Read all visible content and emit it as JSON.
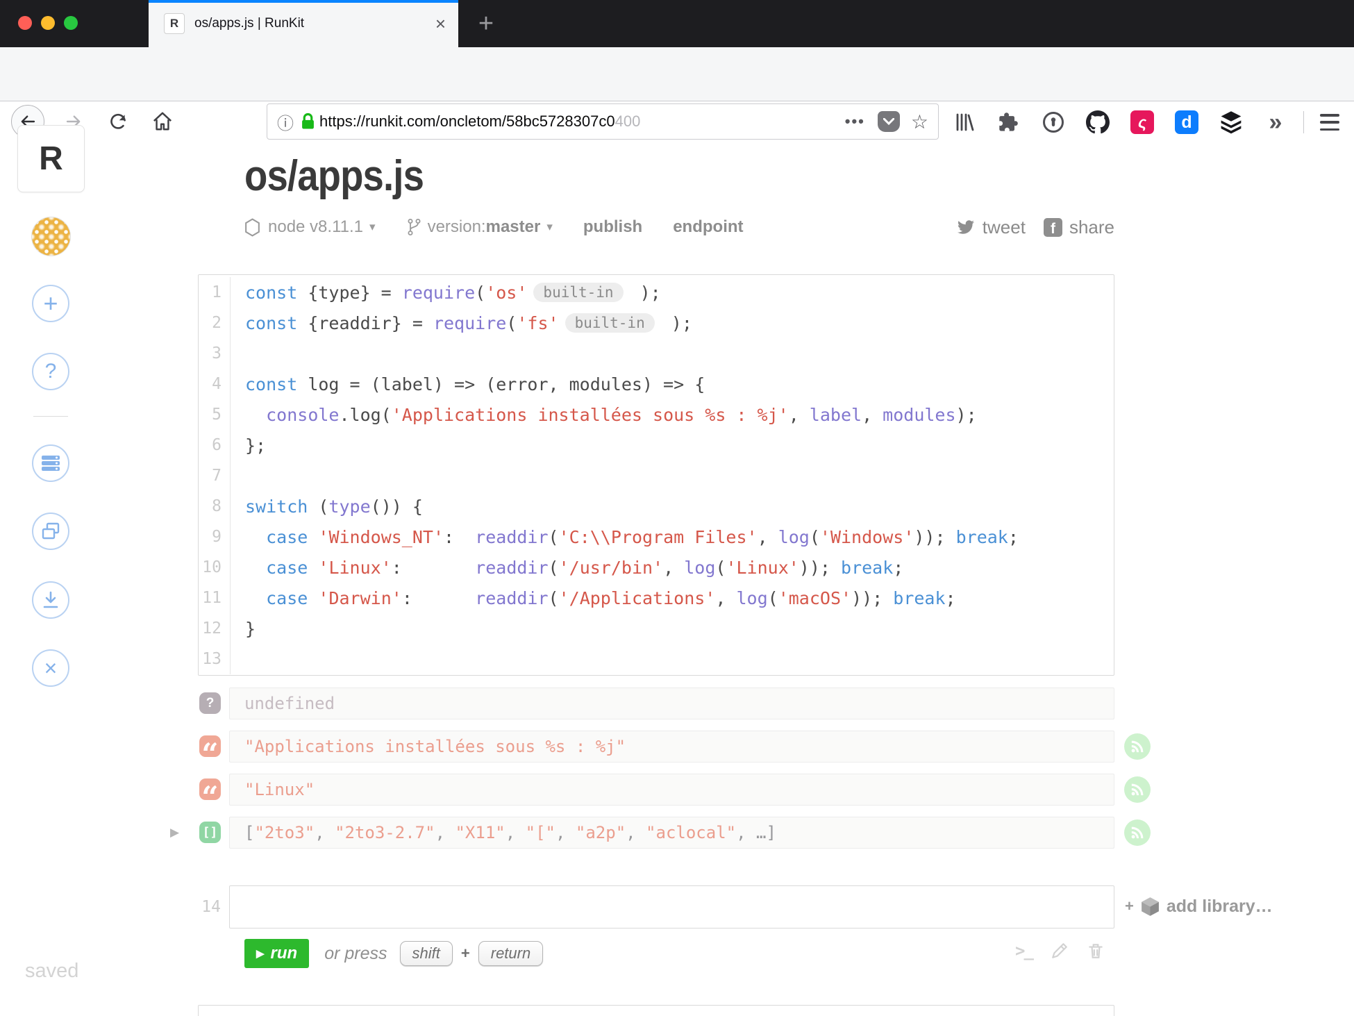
{
  "browser": {
    "tab": {
      "favicon": "R",
      "title": "os/apps.js | RunKit",
      "close": "×",
      "new_tab": "+"
    },
    "nav": {
      "url_main": "https://runkit.com/oncletom/58bc5728307c0",
      "url_dim": "400",
      "page_actions": "•••",
      "star": "☆",
      "info": "ⓘ",
      "overflow": "»"
    },
    "ext_pink_letter": "ς",
    "ext_blue_letter": "d"
  },
  "sidebar": {
    "logo": "R",
    "plus": "+",
    "help": "?",
    "close": "×",
    "saved": "saved"
  },
  "header": {
    "title": "os/apps.js",
    "runtime": "node v8.11.1",
    "caret": "▾",
    "version_label": "version: ",
    "version_value": "master",
    "publish": "publish",
    "endpoint": "endpoint",
    "tweet": "tweet",
    "share": "share",
    "fb_letter": "f"
  },
  "editor": {
    "lines": [
      {
        "n": "1",
        "seg": [
          [
            "kw",
            "const"
          ],
          [
            "pl",
            " {type} = "
          ],
          [
            "fn",
            "require"
          ],
          [
            "pl",
            "("
          ],
          [
            "str",
            "'os'"
          ],
          [
            "pill",
            "built-in"
          ],
          [
            "pl",
            " );"
          ]
        ]
      },
      {
        "n": "2",
        "seg": [
          [
            "kw",
            "const"
          ],
          [
            "pl",
            " {readdir} = "
          ],
          [
            "fn",
            "require"
          ],
          [
            "pl",
            "("
          ],
          [
            "str",
            "'fs'"
          ],
          [
            "pill",
            "built-in"
          ],
          [
            "pl",
            " );"
          ]
        ]
      },
      {
        "n": "3",
        "seg": []
      },
      {
        "n": "4",
        "seg": [
          [
            "kw",
            "const"
          ],
          [
            "pl",
            " log = (label) => (error, modules) => {"
          ]
        ]
      },
      {
        "n": "5",
        "seg": [
          [
            "pl",
            "  "
          ],
          [
            "fn",
            "console"
          ],
          [
            "pl",
            ".log("
          ],
          [
            "str",
            "'Applications installées sous %s : %j'"
          ],
          [
            "pl",
            ", "
          ],
          [
            "fn",
            "label"
          ],
          [
            "pl",
            ", "
          ],
          [
            "fn",
            "modules"
          ],
          [
            "pl",
            ");"
          ]
        ]
      },
      {
        "n": "6",
        "seg": [
          [
            "pl",
            "};"
          ]
        ]
      },
      {
        "n": "7",
        "seg": []
      },
      {
        "n": "8",
        "seg": [
          [
            "kw",
            "switch"
          ],
          [
            "pl",
            " ("
          ],
          [
            "fn",
            "type"
          ],
          [
            "pl",
            "()) {"
          ]
        ]
      },
      {
        "n": "9",
        "seg": [
          [
            "pl",
            "  "
          ],
          [
            "kw",
            "case"
          ],
          [
            "pl",
            " "
          ],
          [
            "str",
            "'Windows_NT'"
          ],
          [
            "pl",
            ":  "
          ],
          [
            "fn",
            "readdir"
          ],
          [
            "pl",
            "("
          ],
          [
            "str",
            "'C:\\\\Program Files'"
          ],
          [
            "pl",
            ", "
          ],
          [
            "fn",
            "log"
          ],
          [
            "pl",
            "("
          ],
          [
            "str",
            "'Windows'"
          ],
          [
            "pl",
            ")); "
          ],
          [
            "kw",
            "break"
          ],
          [
            "pl",
            ";"
          ]
        ]
      },
      {
        "n": "10",
        "seg": [
          [
            "pl",
            "  "
          ],
          [
            "kw",
            "case"
          ],
          [
            "pl",
            " "
          ],
          [
            "str",
            "'Linux'"
          ],
          [
            "pl",
            ":       "
          ],
          [
            "fn",
            "readdir"
          ],
          [
            "pl",
            "("
          ],
          [
            "str",
            "'/usr/bin'"
          ],
          [
            "pl",
            ", "
          ],
          [
            "fn",
            "log"
          ],
          [
            "pl",
            "("
          ],
          [
            "str",
            "'Linux'"
          ],
          [
            "pl",
            ")); "
          ],
          [
            "kw",
            "break"
          ],
          [
            "pl",
            ";"
          ]
        ]
      },
      {
        "n": "11",
        "seg": [
          [
            "pl",
            "  "
          ],
          [
            "kw",
            "case"
          ],
          [
            "pl",
            " "
          ],
          [
            "str",
            "'Darwin'"
          ],
          [
            "pl",
            ":      "
          ],
          [
            "fn",
            "readdir"
          ],
          [
            "pl",
            "("
          ],
          [
            "str",
            "'/Applications'"
          ],
          [
            "pl",
            ", "
          ],
          [
            "fn",
            "log"
          ],
          [
            "pl",
            "("
          ],
          [
            "str",
            "'macOS'"
          ],
          [
            "pl",
            ")); "
          ],
          [
            "kw",
            "break"
          ],
          [
            "pl",
            ";"
          ]
        ]
      },
      {
        "n": "12",
        "seg": [
          [
            "pl",
            "}"
          ]
        ]
      },
      {
        "n": "13",
        "seg": []
      }
    ],
    "next_line": "14"
  },
  "outputs": {
    "cell1": {
      "badge": "?",
      "text": "undefined"
    },
    "cell2": {
      "badge": "“",
      "text": "\"Applications installées sous %s : %j\""
    },
    "cell3": {
      "badge": "“",
      "text": "\"Linux\""
    },
    "cell4": {
      "badge": "[]",
      "disclosure": "▶",
      "segments": [
        [
          "pl",
          "["
        ],
        [
          "str",
          "\"2to3\""
        ],
        [
          "pl",
          ", "
        ],
        [
          "str",
          "\"2to3-2.7\""
        ],
        [
          "pl",
          ", "
        ],
        [
          "str",
          "\"X11\""
        ],
        [
          "pl",
          ", "
        ],
        [
          "str",
          "\"[\""
        ],
        [
          "pl",
          ", "
        ],
        [
          "str",
          "\"a2p\""
        ],
        [
          "pl",
          ", "
        ],
        [
          "str",
          "\"aclocal\""
        ],
        [
          "pl",
          ", …]"
        ]
      ]
    }
  },
  "footer": {
    "run": "run",
    "run_tri": "▶",
    "or_press": "or press",
    "shift": "shift",
    "plus": "+",
    "return": "return",
    "add_library_plus": "+",
    "add_library": "add library…",
    "terminal": ">_"
  }
}
